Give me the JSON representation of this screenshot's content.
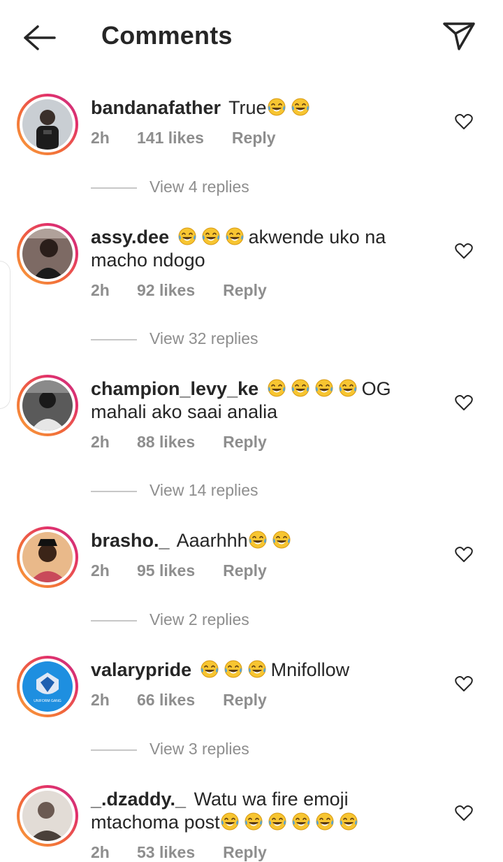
{
  "header": {
    "title": "Comments",
    "back_icon": "arrow-left-icon",
    "share_icon": "paper-plane-icon"
  },
  "colors": {
    "text": "#262626",
    "muted": "#8e8e8e",
    "ring_start": "#f9a23c",
    "ring_end": "#c13584"
  },
  "comments": [
    {
      "username": "bandanafather",
      "text_before": "True",
      "text_after": "",
      "emoji_count": 2,
      "time": "2h",
      "likes": "141 likes",
      "reply": "Reply",
      "view_replies": "View 4 replies"
    },
    {
      "username": "assy.dee",
      "text_before": "",
      "text_after": "akwende uko na macho ndogo",
      "emoji_count": 3,
      "time": "2h",
      "likes": "92 likes",
      "reply": "Reply",
      "view_replies": "View 32 replies"
    },
    {
      "username": "champion_levy_ke",
      "text_before": "",
      "text_after": "OG mahali ako saai analia",
      "emoji_count": 4,
      "time": "2h",
      "likes": "88 likes",
      "reply": "Reply",
      "view_replies": "View 14 replies"
    },
    {
      "username": "brasho._",
      "text_before": "Aaarhhh",
      "text_after": "",
      "emoji_count": 2,
      "time": "2h",
      "likes": "95 likes",
      "reply": "Reply",
      "view_replies": "View 2 replies"
    },
    {
      "username": "valarypride",
      "text_before": "",
      "text_after": "Mnifollow",
      "emoji_count": 3,
      "time": "2h",
      "likes": "66 likes",
      "reply": "Reply",
      "view_replies": "View 3 replies"
    },
    {
      "username": "_.dzaddy._",
      "text_before": "Watu wa fire emoji mtachoma post",
      "text_after": "",
      "emoji_count": 6,
      "time": "2h",
      "likes": "53 likes",
      "reply": "Reply",
      "view_replies": ""
    }
  ],
  "avatar_labels": {
    "valarypride": "UNIFORM GANG"
  }
}
